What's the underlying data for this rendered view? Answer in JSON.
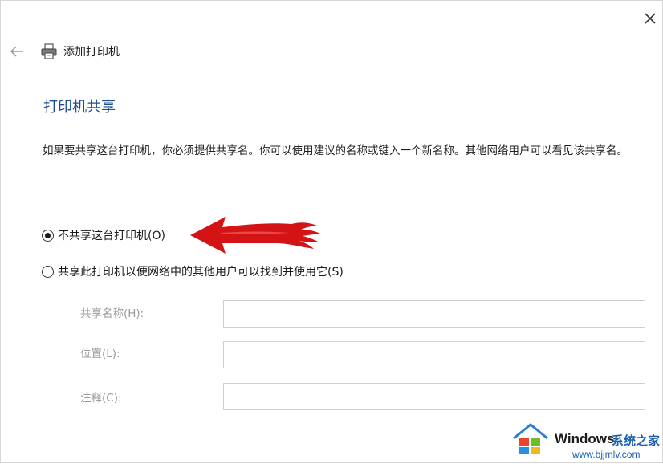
{
  "window": {
    "title": "添加打印机"
  },
  "page": {
    "title": "打印机共享",
    "description": "如果要共享这台打印机，你必须提供共享名。你可以使用建议的名称或键入一个新名称。其他网络用户可以看见该共享名。"
  },
  "options": [
    {
      "label": "不共享这台打印机(O)",
      "checked": true
    },
    {
      "label": "共享此打印机以便网络中的其他用户可以找到并使用它(S)",
      "checked": false
    }
  ],
  "fields": [
    {
      "label": "共享名称(H):",
      "value": ""
    },
    {
      "label": "位置(L):",
      "value": ""
    },
    {
      "label": "注释(C):",
      "value": ""
    }
  ],
  "watermark": {
    "brand": "Windows",
    "site_name": "系统之家",
    "url": "www.bjjmlv.com"
  },
  "icons": {
    "close": "close-icon",
    "back": "back-arrow-icon",
    "printer": "printer-icon",
    "annotation": "red-arrow-icon"
  },
  "colors": {
    "title": "#1f4e8f",
    "arrow": "#d41414",
    "disabled_text": "#9a9a9a"
  }
}
